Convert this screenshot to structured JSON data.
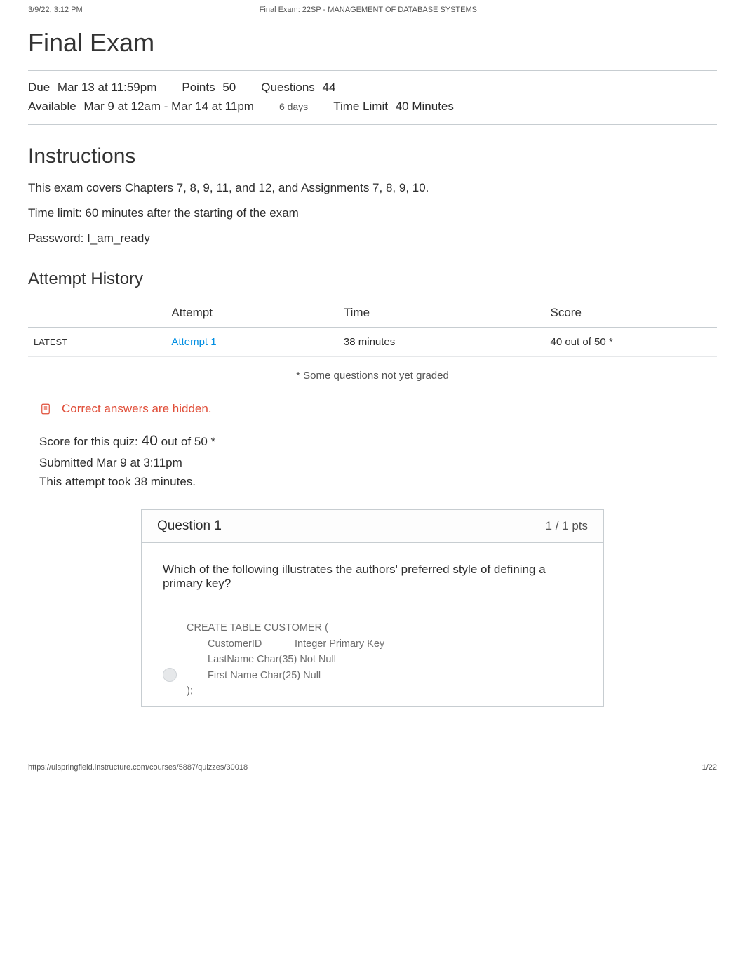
{
  "print_header": {
    "left": "3/9/22, 3:12 PM",
    "center": "Final Exam: 22SP - MANAGEMENT OF DATABASE SYSTEMS"
  },
  "title": "Final Exam",
  "meta": {
    "due_label": "Due",
    "due_value": "Mar 13 at 11:59pm",
    "points_label": "Points",
    "points_value": "50",
    "questions_label": "Questions",
    "questions_value": "44",
    "available_label": "Available",
    "available_value": "Mar 9 at 12am - Mar 14 at 11pm",
    "available_note": "6 days",
    "time_limit_label": "Time Limit",
    "time_limit_value": "40 Minutes"
  },
  "instructions": {
    "heading": "Instructions",
    "p1": "This exam covers Chapters 7, 8, 9, 11, and 12, and Assignments 7, 8, 9, 10.",
    "p2": "Time limit: 60 minutes after the starting of the exam",
    "p3": "Password: I_am_ready"
  },
  "attempt_history": {
    "heading": "Attempt History",
    "columns": {
      "blank": "",
      "attempt": "Attempt",
      "time": "Time",
      "score": "Score"
    },
    "rows": [
      {
        "tag": "LATEST",
        "attempt_label": "Attempt 1",
        "time": "38 minutes",
        "score": "40 out of 50 *"
      }
    ],
    "footnote": "* Some questions not yet graded"
  },
  "hidden_banner": "Correct answers are hidden.",
  "score_block": {
    "score_prefix": "Score for this quiz: ",
    "score_value": "40",
    "score_suffix": " out of 50 *",
    "submitted": "Submitted Mar 9 at 3:11pm",
    "duration": "This attempt took 38 minutes."
  },
  "question1": {
    "heading": "Question 1",
    "pts": "1 / 1 pts",
    "prompt": "Which of the following illustrates the authors' preferred style of defining a primary key?",
    "answer1": {
      "l1": "CREATE TABLE CUSTOMER (",
      "r1a": "CustomerID",
      "r1b": "Integer Primary Key",
      "r2a": "LastName    Char(35)",
      "r2b": "Not Null",
      "r3a": "First Name Char(25)",
      "r3b": "Null",
      "l5": ");"
    }
  },
  "print_footer": {
    "url": "https://uispringfield.instructure.com/courses/5887/quizzes/30018",
    "page": "1/22"
  }
}
